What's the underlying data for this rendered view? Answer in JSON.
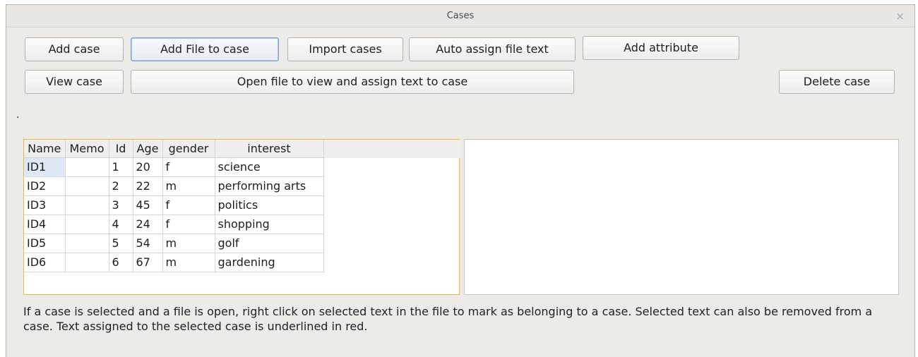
{
  "window": {
    "title": "Cases",
    "close_glyph": "×"
  },
  "buttons": {
    "add_case": "Add case",
    "add_file_to_case": "Add File to case",
    "import_cases": "Import cases",
    "auto_assign": "Auto assign file text",
    "add_attribute": "Add attribute",
    "view_case": "View case",
    "open_file": "Open file to view and assign text to case",
    "delete_case": "Delete case"
  },
  "status_dot": ".",
  "table": {
    "headers": [
      "Name",
      "Memo",
      "Id",
      "Age",
      "gender",
      "interest"
    ],
    "rows": [
      [
        "ID1",
        "",
        "1",
        "20",
        "f",
        "science"
      ],
      [
        "ID2",
        "",
        "2",
        "22",
        "m",
        "performing arts"
      ],
      [
        "ID3",
        "",
        "3",
        "45",
        "f",
        "politics"
      ],
      [
        "ID4",
        "",
        "4",
        "24",
        "f",
        "shopping"
      ],
      [
        "ID5",
        "",
        "5",
        "54",
        "m",
        "golf"
      ],
      [
        "ID6",
        "",
        "6",
        "67",
        "m",
        "gardening"
      ]
    ]
  },
  "info_text": "If a case is selected and a file is open, right click on selected text in the file to mark as belonging to a case. Selected text can also be removed from a case. Text assigned to the selected case is underlined in red.",
  "icons": {
    "close": "close-icon"
  }
}
